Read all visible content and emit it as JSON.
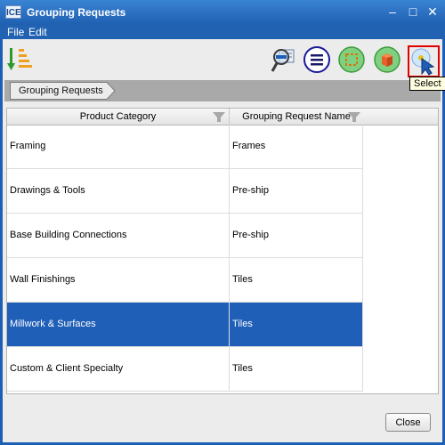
{
  "window": {
    "title": "Grouping Requests",
    "icon_text": "ICE",
    "controls": {
      "minimize": "–",
      "maximize": "□",
      "close": "✕"
    }
  },
  "menubar": {
    "items": [
      {
        "label": "File"
      },
      {
        "label": "Edit"
      }
    ]
  },
  "toolbar": {
    "buttons": [
      {
        "icon": "sort-order-icon"
      },
      {
        "icon": "search-filter-icon"
      },
      {
        "icon": "list-menu-icon"
      },
      {
        "icon": "select-region-icon"
      },
      {
        "icon": "cube-icon"
      },
      {
        "icon": "select-cursor-icon"
      }
    ]
  },
  "tooltip": "Select",
  "breadcrumb": {
    "label": "Grouping Requests"
  },
  "grid": {
    "columns": [
      {
        "label": "Product Category"
      },
      {
        "label": "Grouping Request Name"
      }
    ],
    "rows": [
      {
        "category": "Framing",
        "request": "Frames",
        "selected": false
      },
      {
        "category": "Drawings & Tools",
        "request": "Pre-ship",
        "selected": false
      },
      {
        "category": "Base Building Connections",
        "request": "Pre-ship",
        "selected": false
      },
      {
        "category": "Wall Finishings",
        "request": "Tiles",
        "selected": false
      },
      {
        "category": "Millwork & Surfaces",
        "request": "Tiles",
        "selected": true
      },
      {
        "category": "Custom & Client Specialty",
        "request": "Tiles",
        "selected": false
      }
    ]
  },
  "footer": {
    "close_label": "Close"
  },
  "colors": {
    "titlebar": "#1f5fb0",
    "selection": "#1f5fb8",
    "highlight_border": "#e00000"
  }
}
